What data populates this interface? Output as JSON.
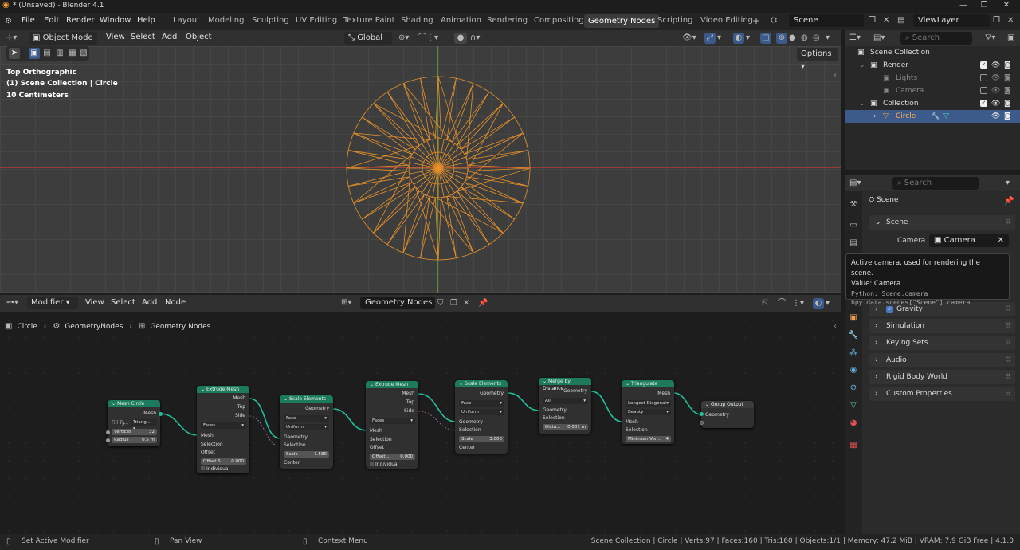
{
  "window": {
    "title": "* (Unsaved) - Blender 4.1"
  },
  "menus": [
    "File",
    "Edit",
    "Render",
    "Window",
    "Help"
  ],
  "workspaces": [
    "Layout",
    "Modeling",
    "Sculpting",
    "UV Editing",
    "Texture Paint",
    "Shading",
    "Animation",
    "Rendering",
    "Compositing",
    "Geometry Nodes",
    "Scripting",
    "Video Editing"
  ],
  "active_workspace": "Geometry Nodes",
  "scene_name": "Scene",
  "view_layer": "ViewLayer",
  "viewport": {
    "mode": "Object Mode",
    "menus": [
      "View",
      "Select",
      "Add",
      "Object"
    ],
    "transform": "Global",
    "options_label": "Options",
    "overlay_lines": [
      "Top Orthographic",
      "(1) Scene Collection | Circle",
      "10 Centimeters"
    ],
    "mesh_color": "#e8922a"
  },
  "node_editor": {
    "type": "Modifier",
    "menus": [
      "View",
      "Select",
      "Add",
      "Node"
    ],
    "tree_name": "Geometry Nodes",
    "breadcrumb": [
      "Circle",
      "GeometryNodes",
      "Geometry Nodes"
    ],
    "nodes": {
      "mesh_circle": {
        "title": "Mesh Circle",
        "out": "Mesh",
        "fill_label": "Fill Ty...",
        "fill_value": "Triangl...",
        "vertices_label": "Vertices",
        "vertices": "32",
        "radius_label": "Radius",
        "radius": "0.5 m"
      },
      "extrude1": {
        "title": "Extrude Mesh",
        "outs": [
          "Mesh",
          "Top",
          "Side"
        ],
        "mode": "Faces",
        "ins": [
          "Mesh",
          "Selection",
          "Offset"
        ],
        "offset_label": "Offset S...",
        "offset": "0.000",
        "individual": "Individual"
      },
      "scale1": {
        "title": "Scale Elements",
        "out": "Geometry",
        "domain": "Face",
        "scale_mode": "Uniform",
        "ins": [
          "Geometry",
          "Selection"
        ],
        "scale_label": "Scale",
        "scale": "1.580",
        "center": "Center"
      },
      "extrude2": {
        "title": "Extrude Mesh",
        "outs": [
          "Mesh",
          "Top",
          "Side"
        ],
        "mode": "Faces",
        "ins": [
          "Mesh",
          "Selection",
          "Offset"
        ],
        "offset_label": "Offset ...",
        "offset": "0.000",
        "individual": "Individual"
      },
      "scale2": {
        "title": "Scale Elements",
        "out": "Geometry",
        "domain": "Face",
        "scale_mode": "Uniform",
        "ins": [
          "Geometry",
          "Selection"
        ],
        "scale_label": "Scale",
        "scale": "3.000",
        "center": "Center"
      },
      "merge": {
        "title": "Merge by Distance",
        "out": "Geometry",
        "mode": "All",
        "ins": [
          "Geometry",
          "Selection"
        ],
        "dist_label": "Dista...",
        "dist": "0.001 m"
      },
      "triangulate": {
        "title": "Triangulate",
        "out": "Mesh",
        "quad": "Longest Diagonal",
        "ngon": "Beauty",
        "ins": [
          "Mesh",
          "Selection"
        ],
        "minv_label": "Minimum Ver...",
        "minv": "4"
      },
      "group_output": {
        "title": "Group Output",
        "in": "Geometry"
      }
    }
  },
  "outliner": {
    "search_placeholder": "Search",
    "items": [
      {
        "label": "Scene Collection"
      },
      {
        "label": "Render"
      },
      {
        "label": "Lights"
      },
      {
        "label": "Camera"
      },
      {
        "label": "Collection"
      },
      {
        "label": "Circle"
      }
    ]
  },
  "properties": {
    "search_placeholder": "Search",
    "context": "Scene",
    "scene_panel": "Scene",
    "camera_label": "Camera",
    "camera_value": "Camera",
    "panels": [
      "Gravity",
      "Simulation",
      "Keying Sets",
      "Audio",
      "Rigid Body World",
      "Custom Properties"
    ]
  },
  "tooltip": {
    "line1": "Active camera, used for rendering the scene.",
    "line2": "Value: Camera",
    "line3": "Python: Scene.camera",
    "line4": "bpy.data.scenes[\"Scene\"].camera"
  },
  "status": {
    "left1": "Set Active Modifier",
    "left2": "Pan View",
    "left3": "Context Menu",
    "right": "Scene Collection | Circle | Verts:97 | Faces:160 | Tris:160 | Objects:1/1 | Memory: 47.2 MiB | VRAM: 7.9 GiB Free | 4.1.0"
  }
}
